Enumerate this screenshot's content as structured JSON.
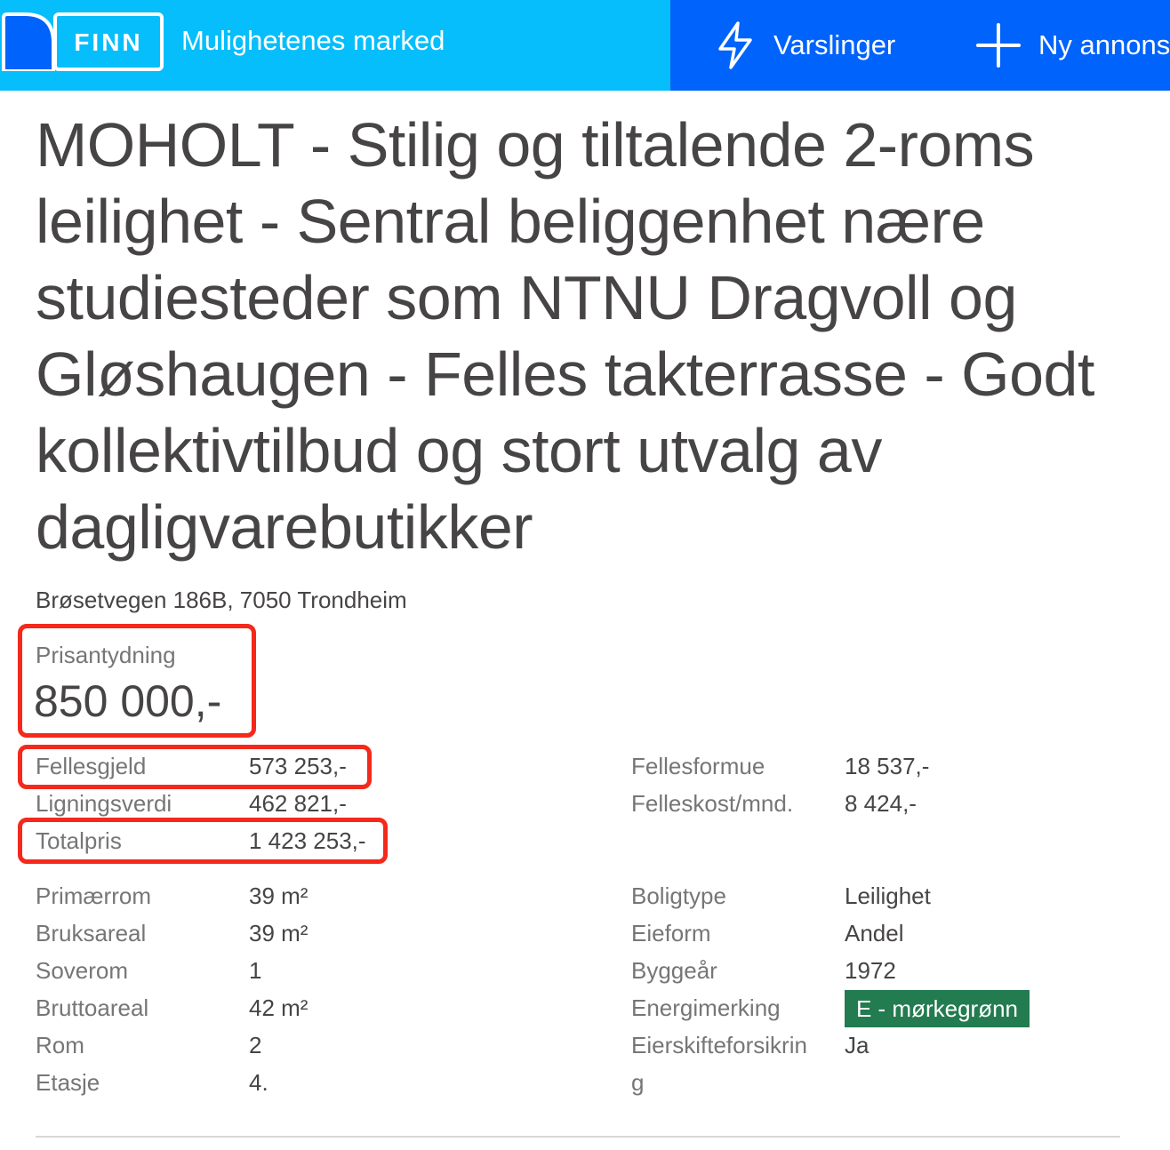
{
  "header": {
    "logo_text": "FINN",
    "tagline": "Mulighetenes marked",
    "alerts_label": "Varslinger",
    "new_ad_label": "Ny annons"
  },
  "listing": {
    "title": "MOHOLT - Stilig og tiltalende 2-roms leilighet - Sentral beliggenhet nære studiesteder som NTNU Dragvoll og Gløshaugen - Felles takterrasse - Godt kollektivtilbud og stort utvalg av dagligvarebutikker",
    "address": "Brøsetvegen 186B, 7050 Trondheim",
    "price_label": "Prisantydning",
    "price_value": "850 000,-"
  },
  "costs_left": [
    {
      "label": "Fellesgjeld",
      "value": "573 253,-"
    },
    {
      "label": "Ligningsverdi",
      "value": "462 821,-"
    },
    {
      "label": "Totalpris",
      "value": "1 423 253,-"
    }
  ],
  "costs_right": [
    {
      "label": "Fellesformue",
      "value": "18 537,-"
    },
    {
      "label": "Felleskost/mnd.",
      "value": "8 424,-"
    }
  ],
  "details_left": [
    {
      "label": "Primærrom",
      "value": "39 m²"
    },
    {
      "label": "Bruksareal",
      "value": "39 m²"
    },
    {
      "label": "Soverom",
      "value": "1"
    },
    {
      "label": "Bruttoareal",
      "value": "42 m²"
    },
    {
      "label": "Rom",
      "value": "2"
    },
    {
      "label": "Etasje",
      "value": "4."
    }
  ],
  "details_right": [
    {
      "label": "Boligtype",
      "value": "Leilighet"
    },
    {
      "label": "Eieform",
      "value": "Andel"
    },
    {
      "label": "Byggeår",
      "value": "1972"
    },
    {
      "label": "Energimerking",
      "value": "E - mørkegrønn"
    },
    {
      "label": "Eierskifteforsikrin",
      "value": "Ja"
    },
    {
      "label": "g",
      "value": ""
    }
  ],
  "colors": {
    "header_light": "#06befb",
    "header_dark": "#0063fb",
    "highlight": "#f5291b",
    "energy_badge": "#237b50"
  }
}
